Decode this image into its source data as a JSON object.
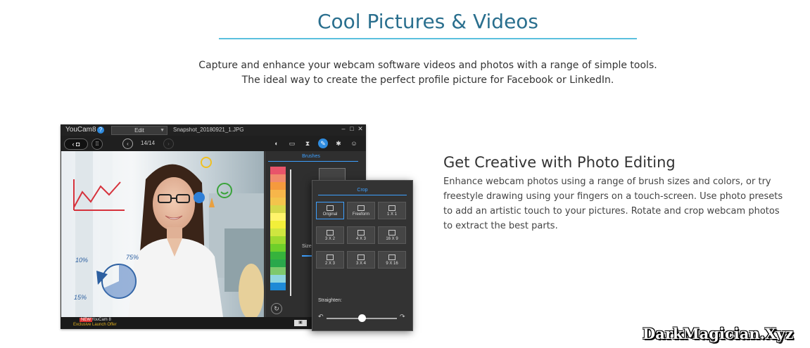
{
  "hero": {
    "title": "Cool Pictures & Videos",
    "subtitle_line1": "Capture and enhance your webcam software videos and photos with a range of simple tools.",
    "subtitle_line2": "The ideal way to create the perfect profile picture for Facebook or LinkedIn."
  },
  "app": {
    "name": "YouCam8",
    "help": "?",
    "mode": "Edit",
    "file": "Snapshot_20180921_1.JPG",
    "counter": "14/14",
    "photo_annotations": [
      "10%",
      "75%",
      "15%"
    ],
    "brushes_title": "Brushes",
    "size_label": "Size:",
    "promo_new": "NEW",
    "promo_title": "YouCam 8",
    "promo_offer": "Exclusive Launch Offer",
    "palette": [
      "#e8546a",
      "#f08a6c",
      "#f59a3d",
      "#f7b64a",
      "#f3c44c",
      "#d6d84a",
      "#fff36b",
      "#f2ef3a",
      "#cfe63f",
      "#9ed92f",
      "#6fcf2a",
      "#36b33c",
      "#2aa84b",
      "#7ec96d",
      "#8fd6e0",
      "#1f8ad6"
    ]
  },
  "crop": {
    "title": "Crop",
    "options": [
      "Original",
      "Freeform",
      "1 X 1",
      "3 X 2",
      "4 X 3",
      "16 X 9",
      "2 X 3",
      "3 X 4",
      "9 X 16"
    ],
    "straighten_label": "Straighten:"
  },
  "feature": {
    "heading": "Get Creative with Photo Editing",
    "body": "Enhance webcam photos using a range of brush sizes and colors, or try freestyle drawing using your fingers on a touch-screen. Use photo presets to add an artistic touch to your pictures. Rotate and crop webcam photos to extract the best parts."
  },
  "watermark": "DarkMagician.Xyz"
}
